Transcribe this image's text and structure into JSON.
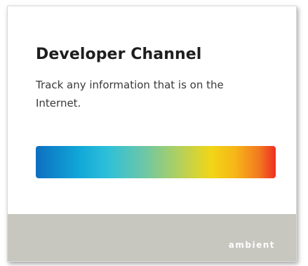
{
  "card": {
    "title": "Developer Channel",
    "description": "Track any information that is on the Internet.",
    "spectrum_colors": [
      "#0d6fc0",
      "#11a7d8",
      "#6cc7a7",
      "#b4d05c",
      "#f1d616",
      "#f27a20",
      "#ee2e24"
    ],
    "footer": {
      "brand": "ambient",
      "background": "#c7c6bf"
    }
  }
}
